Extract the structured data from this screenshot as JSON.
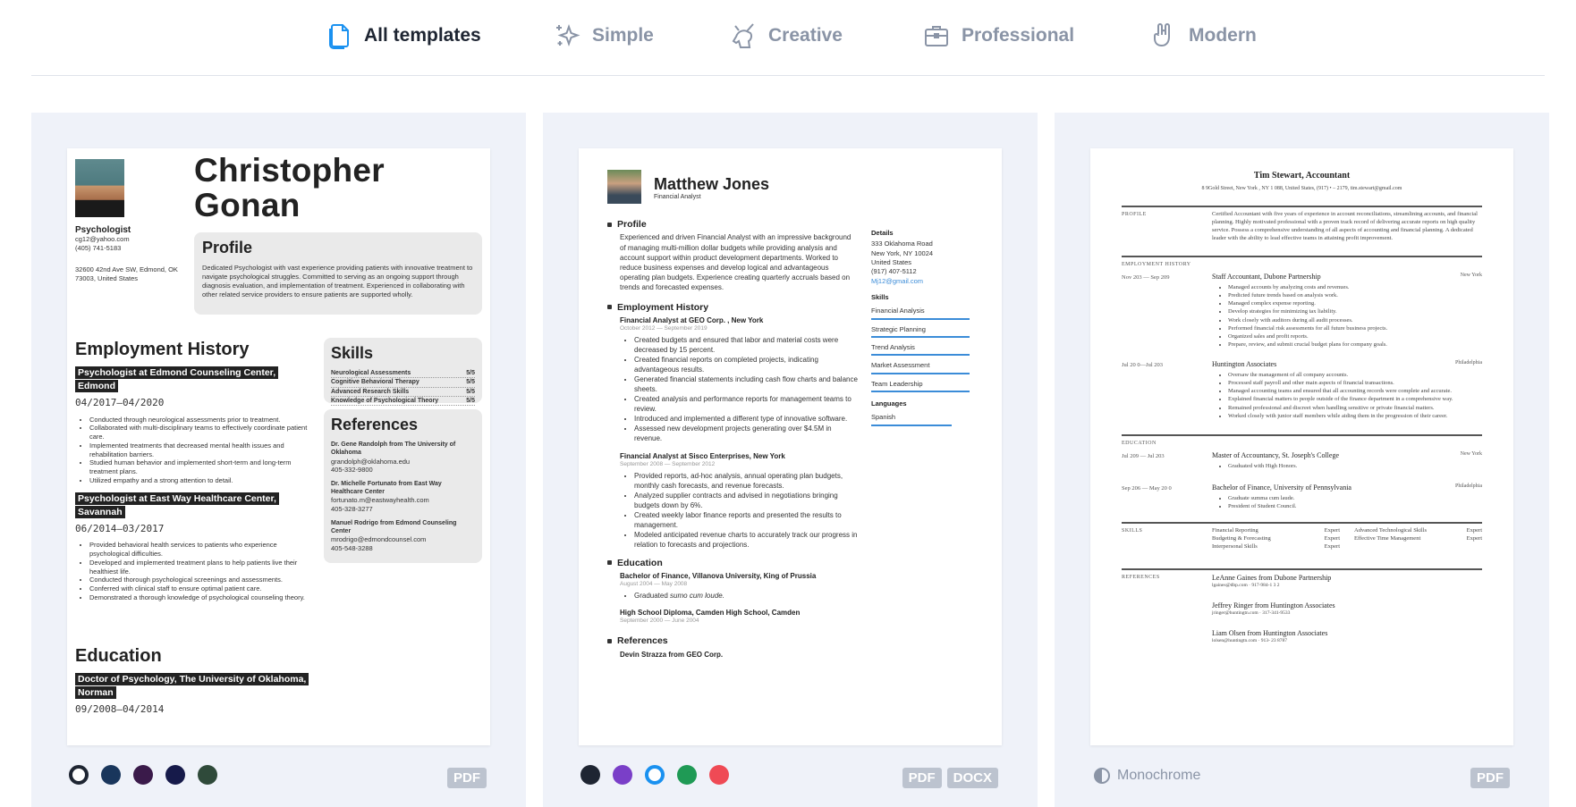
{
  "tabs": [
    {
      "label": "All templates",
      "icon": "document-icon",
      "active": true
    },
    {
      "label": "Simple",
      "icon": "sparkles-icon"
    },
    {
      "label": "Creative",
      "icon": "unicorn-icon"
    },
    {
      "label": "Professional",
      "icon": "briefcase-icon"
    },
    {
      "label": "Modern",
      "icon": "rock-hand-icon"
    }
  ],
  "cards": [
    {
      "swatches": [
        "#1e2532",
        "#19365c",
        "#3a1a4a",
        "#161a4a",
        "#2f4a3a"
      ],
      "badges": [
        "PDF"
      ],
      "resume": {
        "name": "Christopher Gonan",
        "job_title": "Psychologist",
        "email": "cg12@yahoo.com",
        "phone": "(405) 741-5183",
        "address": "32600 42nd Ave SW, Edmond, OK 73003, United States",
        "profile_heading": "Profile",
        "profile_text": "Dedicated Psychologist with vast experience providing patients with innovative treatment to navigate psychological struggles. Committed to serving as an ongoing support through diagnosis evaluation, and implementation of treatment. Experienced in collaborating with other related service providers to ensure patients are supported wholly.",
        "employment_heading": "Employment History",
        "jobs": [
          {
            "title": "Psychologist at Edmond Counseling Center, Edmond",
            "date": "04/2017—04/2020",
            "bullets": [
              "Conducted through neurological assessments prior to treatment.",
              "Collaborated with multi-disciplinary teams to effectively coordinate patient care.",
              "Implemented treatments that decreased mental health issues and rehabilitation barriers.",
              "Studied human behavior and implemented short-term and long-term treatment plans.",
              "Utilized empathy and a strong attention to detail."
            ]
          },
          {
            "title": "Psychologist at East Way Healthcare Center, Savannah",
            "date": "06/2014—03/2017",
            "bullets": [
              "Provided behavioral health services to patients who experience psychological difficulties.",
              "Developed and implemented treatment plans to help patients live their healthiest life.",
              "Conducted thorough psychological screenings and assessments.",
              "Conferred with clinical staff to ensure optimal patient care.",
              "Demonstrated a thorough knowledge of psychological counseling theory."
            ]
          }
        ],
        "skills_heading": "Skills",
        "skills": [
          {
            "name": "Neurological Assessments",
            "level": "5/5"
          },
          {
            "name": "Cognitive Behavioral Therapy",
            "level": "5/5"
          },
          {
            "name": "Advanced Research Skills",
            "level": "5/5"
          },
          {
            "name": "Knowledge of Psychological Theory",
            "level": "5/5"
          }
        ],
        "references_heading": "References",
        "references": [
          {
            "name": "Dr. Gene Randolph from The University of Oklahoma",
            "email": "grandolph@oklahoma.edu",
            "phone": "405-332-9800"
          },
          {
            "name": "Dr. Michelle Fortunato from East Way Healthcare Center",
            "email": "fortunato.m@eastwayhealth.com",
            "phone": "405-328-3277"
          },
          {
            "name": "Manuel Rodrigo from Edmond Counseling Center",
            "email": "mrodrigo@edmondcounsel.com",
            "phone": "405-548-3288"
          }
        ],
        "education_heading": "Education",
        "education": {
          "title": "Doctor of Psychology, The University of Oklahoma, Norman",
          "date": "09/2008—04/2014"
        }
      }
    },
    {
      "swatches": [
        "#1e2532",
        "#7a3fc8",
        "#1a91f0",
        "#1f9a55",
        "#ef4a55"
      ],
      "badges": [
        "PDF",
        "DOCX"
      ],
      "resume": {
        "name": "Matthew Jones",
        "subtitle": "Financial Analyst",
        "profile_heading": "Profile",
        "profile_text": "Experienced and driven Financial Analyst with an impressive background of managing multi-million dollar budgets while providing analysis and account support within product development departments. Worked to reduce business expenses and develop logical and advantageous operating plan budgets. Experience creating quarterly accruals based on trends and forecasted expenses.",
        "employment_heading": "Employment History",
        "jobs": [
          {
            "title": "Financial Analyst at GEO Corp. , New York",
            "date": "October 2012 — September 2019",
            "bullets": [
              "Created budgets and ensured that labor and material costs were decreased by 15 percent.",
              "Created financial reports on completed projects, indicating advantageous results.",
              "Generated financial statements including cash flow charts and balance sheets.",
              "Created analysis and performance reports for management teams to review.",
              "Introduced and implemented a different type of innovative software.",
              "Assessed new development projects generating over $4.5M in revenue."
            ]
          },
          {
            "title": "Financial Analyst at Sisco Enterprises, New York",
            "date": "September 2008 — September 2012",
            "bullets": [
              "Provided reports, ad-hoc analysis, annual operating plan budgets, monthly cash forecasts, and revenue forecasts.",
              "Analyzed supplier contracts and advised in negotiations bringing budgets down by 6%.",
              "Created weekly labor finance reports and presented the results to management.",
              "Modeled anticipated revenue charts to accurately track our progress in relation to forecasts and projections."
            ]
          }
        ],
        "education_heading": "Education",
        "education": [
          {
            "title": "Bachelor of Finance, Villanova University, King of Prussia",
            "date": "August 2004 — May 2008",
            "note_prefix": "Graduated ",
            "note_italic": "sumo cum loude."
          },
          {
            "title": "High School Diploma, Camden High School, Camden",
            "date": "September 2000 — June 2004"
          }
        ],
        "references_heading": "References",
        "reference": "Devin Strazza from GEO Corp.",
        "details_heading": "Details",
        "details": [
          "333 Oklahoma Road",
          "New York, NY 10024",
          "United States",
          "(917) 407-5112"
        ],
        "details_email": "Mj12@gmail.com",
        "skills_heading": "Skills",
        "skills": [
          "Financial Analysis",
          "Strategic Planning",
          "Trend Analysis",
          "Market Assessment",
          "Team Leadership"
        ],
        "languages_heading": "Languages",
        "languages": [
          "Spanish"
        ]
      }
    },
    {
      "mode_label": "Monochrome",
      "badges": [
        "PDF"
      ],
      "resume": {
        "name": "Tim Stewart, Accountant",
        "contact": "8 9Gold Street, New York , NY 1 088, United States, (917) • – 2179, tim.stewart@gmail.com",
        "profile_label": "PROFILE",
        "profile_text": "Certified Accountant with five years of experience in account reconciliations, streamlining accounts, and financial planning. Highly motivated professional with a proven track record of delivering accurate reports on high quality service. Possess a comprehensive understanding of all aspects of accounting and financial planning. A dedicated leader with the ability to lead effective teams in attaining profit improvement.",
        "employment_label": "EMPLOYMENT HISTORY",
        "jobs": [
          {
            "date": "Nov 203 — Sep 209",
            "title": "Staff Accountant, Dubone Partnership",
            "place": "New York",
            "bullets": [
              "Managed accounts by analyzing costs and revenues.",
              "Predicted future trends based on analysis work.",
              "Managed complex expense reporting.",
              "Develop strategies for minimizing tax liability.",
              "Work closely with auditors during all audit processes.",
              "Performed financial risk assessments for all future business projects.",
              "Organized sales and profit reports.",
              "Prepare, review, and submit crucial budget plans for company goals."
            ]
          },
          {
            "date": "Jul 20 0—Jul 203",
            "title": "Huntington Associates",
            "place": "Philadelphia",
            "bullets": [
              "Oversaw the management of all company accounts.",
              "Processed staff payroll and other main aspects of financial transactions.",
              "Managed accounting teams and ensured that all accounting records were complete and accurate.",
              "Explained financial matters to people outside of the finance department in a comprehensive way.",
              "Remained professional and discreet when handling sensitive or private financial matters.",
              "Worked closely with junior staff members while aiding them in the progression of their career."
            ]
          }
        ],
        "education_label": "EDUCATION",
        "education": [
          {
            "date": "Jul 209 — Jul 203",
            "title": "Master of Accountancy, St. Joseph's College",
            "place": "New York",
            "bullets": [
              "Graduated with High Honors."
            ]
          },
          {
            "date": "Sep 206 — May 20 0",
            "title": "Bachelor of Finance, University of Pennsylvania",
            "place": "Philadelphia",
            "bullets": [
              "Graduate summa cum laude.",
              "President of Student Council."
            ]
          }
        ],
        "skills_label": "SKILLS",
        "skills": [
          {
            "name": "Financial Reporting",
            "level": "Expert"
          },
          {
            "name": "Advanced Technological Skills",
            "level": "Expert"
          },
          {
            "name": "Budgeting & Forecasting",
            "level": "Expert"
          },
          {
            "name": "Effective Time Management",
            "level": "Expert"
          },
          {
            "name": "Interpersonal Skills",
            "level": "Expert"
          }
        ],
        "references_label": "REFERENCES",
        "references": [
          {
            "name": "LeAnne Gaines from Dubone Partnership",
            "contact": "lgaines@dbp.com · 917-984-1 3 2"
          },
          {
            "name": "Jeffrey Ringer from Huntington Associates",
            "contact": "jringer@huntingtn.com · 317-341-9533"
          },
          {
            "name": "Liam Olsen from Huntington Associates",
            "contact": "lolsen@huntingtn.com · 913- 23 8787"
          }
        ]
      }
    }
  ]
}
